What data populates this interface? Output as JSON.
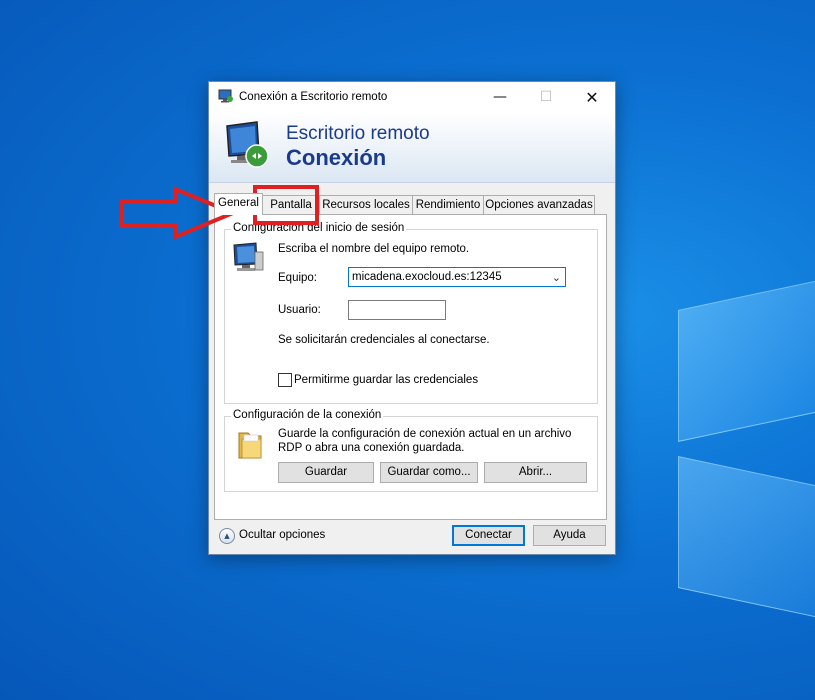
{
  "window": {
    "title": "Conexión a Escritorio remoto",
    "controls": {
      "minimize": "—",
      "maximize": "☐",
      "close": "✕"
    }
  },
  "banner": {
    "line1": "Escritorio remoto",
    "line2": "Conexión"
  },
  "tabs": [
    {
      "label": "General",
      "active": true
    },
    {
      "label": "Pantalla",
      "active": false
    },
    {
      "label": "Recursos locales",
      "active": false
    },
    {
      "label": "Rendimiento",
      "active": false
    },
    {
      "label": "Opciones avanzadas",
      "active": false
    }
  ],
  "login_group": {
    "title": "Configuración del inicio de sesión",
    "instruction": "Escriba el nombre del equipo remoto.",
    "computer_label": "Equipo:",
    "computer_value": "micadena.exocloud.es:12345",
    "user_label": "Usuario:",
    "user_value": "",
    "credentials_note": "Se solicitarán credenciales al conectarse.",
    "save_credentials_label": "Permitirme guardar las credenciales",
    "save_credentials_checked": false
  },
  "connection_group": {
    "title": "Configuración de la conexión",
    "description_line1": "Guarde la configuración de conexión actual en un archivo",
    "description_line2": "RDP o abra una conexión guardada.",
    "save_label": "Guardar",
    "save_as_label": "Guardar como...",
    "open_label": "Abrir..."
  },
  "footer": {
    "hide_options_label": "Ocultar opciones",
    "connect_label": "Conectar",
    "help_label": "Ayuda"
  },
  "annotation_colors": {
    "highlight": "#e02020"
  }
}
